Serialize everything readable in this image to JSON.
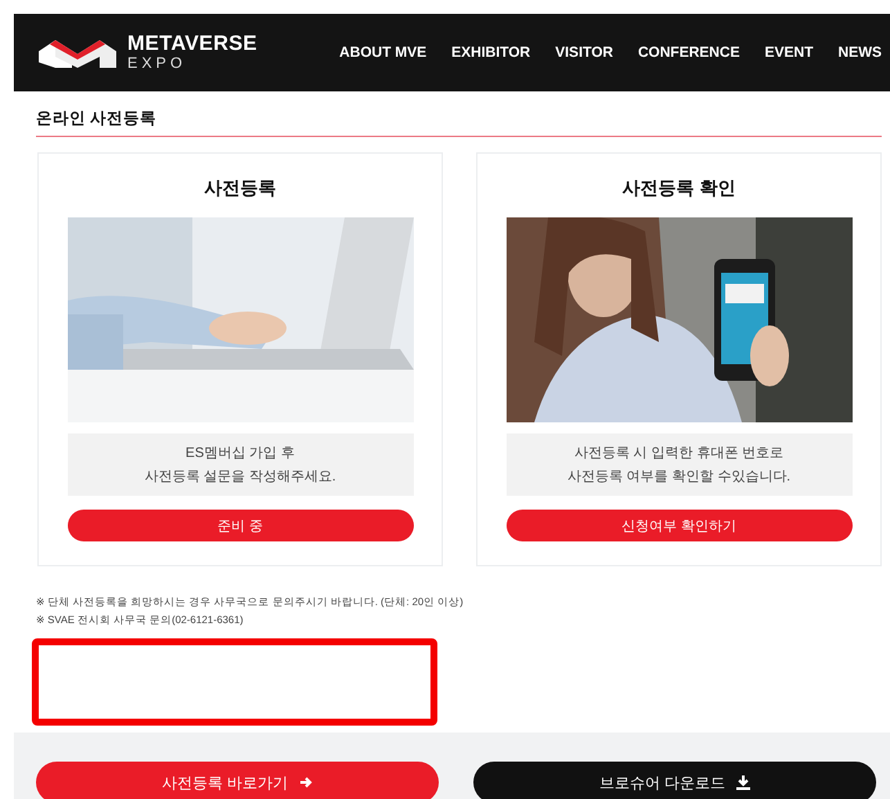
{
  "header": {
    "logo_title": "METAVERSE",
    "logo_subtitle": "EXPO",
    "nav": [
      {
        "label": "ABOUT MVE"
      },
      {
        "label": "EXHIBITOR"
      },
      {
        "label": "VISITOR"
      },
      {
        "label": "CONFERENCE"
      },
      {
        "label": "EVENT"
      },
      {
        "label": "NEWS"
      }
    ]
  },
  "section_title": "온라인 사전등록",
  "cards": [
    {
      "title": "사전등록",
      "desc": [
        "ES멤버십 가입 후",
        "사전등록 설문을 작성해주세요."
      ],
      "button": "준비 중"
    },
    {
      "title": "사전등록 확인",
      "desc": [
        "사전등록 시 입력한 휴대폰 번호로",
        "사전등록 여부를 확인할 수있습니다."
      ],
      "button": "신청여부 확인하기"
    }
  ],
  "notes": [
    "※ 단체 사전등록을 희망하시는 경우 사무국으로 문의주시기 바랍니다. (단체: 20인 이상)",
    "※ SVAE 전시회 사무국 문의(02-6121-6361)"
  ],
  "footer_buttons": [
    {
      "label": "사전등록 바로가기",
      "kind": "arrow"
    },
    {
      "label": "브로슈어 다운로드",
      "kind": "download"
    }
  ]
}
